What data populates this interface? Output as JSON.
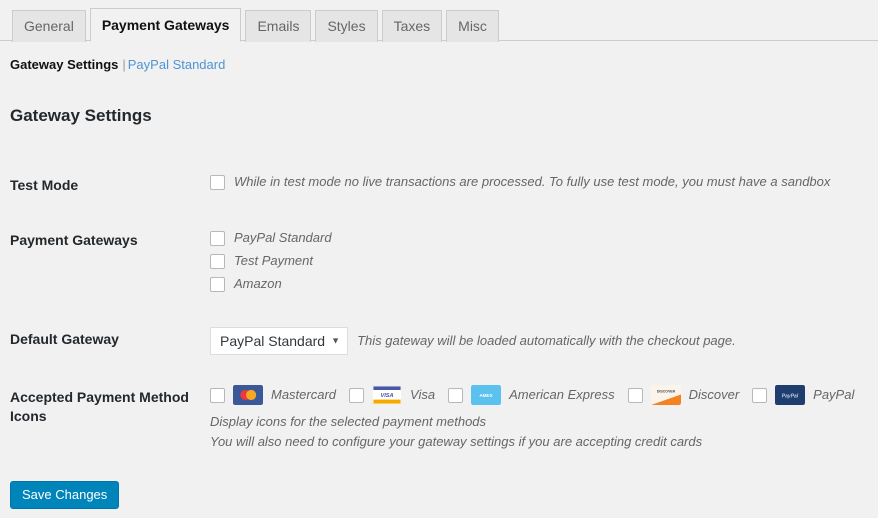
{
  "tabs": [
    {
      "label": "General",
      "active": false
    },
    {
      "label": "Payment Gateways",
      "active": true
    },
    {
      "label": "Emails",
      "active": false
    },
    {
      "label": "Styles",
      "active": false
    },
    {
      "label": "Taxes",
      "active": false
    },
    {
      "label": "Misc",
      "active": false
    }
  ],
  "subnav": {
    "current": "Gateway Settings",
    "separator": "|",
    "link": "PayPal Standard"
  },
  "heading": "Gateway Settings",
  "fields": {
    "test_mode": {
      "label": "Test Mode",
      "checked": false,
      "description": "While in test mode no live transactions are processed. To fully use test mode, you must have a sandbox"
    },
    "payment_gateways": {
      "label": "Payment Gateways",
      "options": [
        {
          "label": "PayPal Standard",
          "checked": false
        },
        {
          "label": "Test Payment",
          "checked": false
        },
        {
          "label": "Amazon",
          "checked": false
        }
      ]
    },
    "default_gateway": {
      "label": "Default Gateway",
      "value": "PayPal Standard",
      "caret": "▼",
      "description": "This gateway will be loaded automatically with the checkout page."
    },
    "accepted_icons": {
      "label": "Accepted Payment Method Icons",
      "methods": [
        {
          "label": "Mastercard",
          "checked": false,
          "icon": "mastercard-icon"
        },
        {
          "label": "Visa",
          "checked": false,
          "icon": "visa-icon"
        },
        {
          "label": "American Express",
          "checked": false,
          "icon": "amex-icon"
        },
        {
          "label": "Discover",
          "checked": false,
          "icon": "discover-icon"
        },
        {
          "label": "PayPal",
          "checked": false,
          "icon": "paypal-icon"
        }
      ],
      "notes": [
        "Display icons for the selected payment methods",
        "You will also need to configure your gateway settings if you are accepting credit cards"
      ]
    }
  },
  "submit": {
    "label": "Save Changes"
  },
  "colors": {
    "page_bg": "#f1f1f1",
    "tab_bg": "#e5e5e5",
    "link": "#4f94d4",
    "primary_button": "#0085ba",
    "mastercard_bg": "#3b5998",
    "mastercard_red": "#eb3a3a",
    "mastercard_orange": "#f7a823",
    "visa_blue": "#4a56a6",
    "visa_gold": "#f5a800",
    "amex_blue": "#5bc2ef",
    "discover_orange": "#f58220",
    "paypal_navy": "#1f3d6e"
  }
}
